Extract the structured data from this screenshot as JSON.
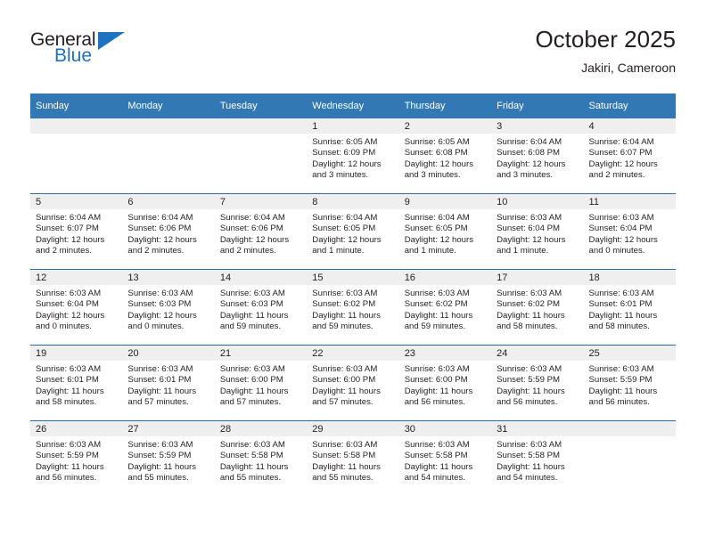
{
  "brand": {
    "name_top": "General",
    "name_bottom": "Blue",
    "accent_color": "#1f72bd"
  },
  "header": {
    "title": "October 2025",
    "location": "Jakiri, Cameroon"
  },
  "theme": {
    "header_bg": "#3178b4",
    "daynum_bg": "#efefef",
    "row_divider": "#2e6da4",
    "text": "#231f20"
  },
  "weekday_headers": [
    "Sunday",
    "Monday",
    "Tuesday",
    "Wednesday",
    "Thursday",
    "Friday",
    "Saturday"
  ],
  "weeks": [
    [
      {
        "day": "",
        "sunrise": "",
        "sunset": "",
        "daylight": "",
        "empty": true
      },
      {
        "day": "",
        "sunrise": "",
        "sunset": "",
        "daylight": "",
        "empty": true
      },
      {
        "day": "",
        "sunrise": "",
        "sunset": "",
        "daylight": "",
        "empty": true
      },
      {
        "day": "1",
        "sunrise": "Sunrise: 6:05 AM",
        "sunset": "Sunset: 6:09 PM",
        "daylight": "Daylight: 12 hours and 3 minutes."
      },
      {
        "day": "2",
        "sunrise": "Sunrise: 6:05 AM",
        "sunset": "Sunset: 6:08 PM",
        "daylight": "Daylight: 12 hours and 3 minutes."
      },
      {
        "day": "3",
        "sunrise": "Sunrise: 6:04 AM",
        "sunset": "Sunset: 6:08 PM",
        "daylight": "Daylight: 12 hours and 3 minutes."
      },
      {
        "day": "4",
        "sunrise": "Sunrise: 6:04 AM",
        "sunset": "Sunset: 6:07 PM",
        "daylight": "Daylight: 12 hours and 2 minutes."
      }
    ],
    [
      {
        "day": "5",
        "sunrise": "Sunrise: 6:04 AM",
        "sunset": "Sunset: 6:07 PM",
        "daylight": "Daylight: 12 hours and 2 minutes."
      },
      {
        "day": "6",
        "sunrise": "Sunrise: 6:04 AM",
        "sunset": "Sunset: 6:06 PM",
        "daylight": "Daylight: 12 hours and 2 minutes."
      },
      {
        "day": "7",
        "sunrise": "Sunrise: 6:04 AM",
        "sunset": "Sunset: 6:06 PM",
        "daylight": "Daylight: 12 hours and 2 minutes."
      },
      {
        "day": "8",
        "sunrise": "Sunrise: 6:04 AM",
        "sunset": "Sunset: 6:05 PM",
        "daylight": "Daylight: 12 hours and 1 minute."
      },
      {
        "day": "9",
        "sunrise": "Sunrise: 6:04 AM",
        "sunset": "Sunset: 6:05 PM",
        "daylight": "Daylight: 12 hours and 1 minute."
      },
      {
        "day": "10",
        "sunrise": "Sunrise: 6:03 AM",
        "sunset": "Sunset: 6:04 PM",
        "daylight": "Daylight: 12 hours and 1 minute."
      },
      {
        "day": "11",
        "sunrise": "Sunrise: 6:03 AM",
        "sunset": "Sunset: 6:04 PM",
        "daylight": "Daylight: 12 hours and 0 minutes."
      }
    ],
    [
      {
        "day": "12",
        "sunrise": "Sunrise: 6:03 AM",
        "sunset": "Sunset: 6:04 PM",
        "daylight": "Daylight: 12 hours and 0 minutes."
      },
      {
        "day": "13",
        "sunrise": "Sunrise: 6:03 AM",
        "sunset": "Sunset: 6:03 PM",
        "daylight": "Daylight: 12 hours and 0 minutes."
      },
      {
        "day": "14",
        "sunrise": "Sunrise: 6:03 AM",
        "sunset": "Sunset: 6:03 PM",
        "daylight": "Daylight: 11 hours and 59 minutes."
      },
      {
        "day": "15",
        "sunrise": "Sunrise: 6:03 AM",
        "sunset": "Sunset: 6:02 PM",
        "daylight": "Daylight: 11 hours and 59 minutes."
      },
      {
        "day": "16",
        "sunrise": "Sunrise: 6:03 AM",
        "sunset": "Sunset: 6:02 PM",
        "daylight": "Daylight: 11 hours and 59 minutes."
      },
      {
        "day": "17",
        "sunrise": "Sunrise: 6:03 AM",
        "sunset": "Sunset: 6:02 PM",
        "daylight": "Daylight: 11 hours and 58 minutes."
      },
      {
        "day": "18",
        "sunrise": "Sunrise: 6:03 AM",
        "sunset": "Sunset: 6:01 PM",
        "daylight": "Daylight: 11 hours and 58 minutes."
      }
    ],
    [
      {
        "day": "19",
        "sunrise": "Sunrise: 6:03 AM",
        "sunset": "Sunset: 6:01 PM",
        "daylight": "Daylight: 11 hours and 58 minutes."
      },
      {
        "day": "20",
        "sunrise": "Sunrise: 6:03 AM",
        "sunset": "Sunset: 6:01 PM",
        "daylight": "Daylight: 11 hours and 57 minutes."
      },
      {
        "day": "21",
        "sunrise": "Sunrise: 6:03 AM",
        "sunset": "Sunset: 6:00 PM",
        "daylight": "Daylight: 11 hours and 57 minutes."
      },
      {
        "day": "22",
        "sunrise": "Sunrise: 6:03 AM",
        "sunset": "Sunset: 6:00 PM",
        "daylight": "Daylight: 11 hours and 57 minutes."
      },
      {
        "day": "23",
        "sunrise": "Sunrise: 6:03 AM",
        "sunset": "Sunset: 6:00 PM",
        "daylight": "Daylight: 11 hours and 56 minutes."
      },
      {
        "day": "24",
        "sunrise": "Sunrise: 6:03 AM",
        "sunset": "Sunset: 5:59 PM",
        "daylight": "Daylight: 11 hours and 56 minutes."
      },
      {
        "day": "25",
        "sunrise": "Sunrise: 6:03 AM",
        "sunset": "Sunset: 5:59 PM",
        "daylight": "Daylight: 11 hours and 56 minutes."
      }
    ],
    [
      {
        "day": "26",
        "sunrise": "Sunrise: 6:03 AM",
        "sunset": "Sunset: 5:59 PM",
        "daylight": "Daylight: 11 hours and 56 minutes."
      },
      {
        "day": "27",
        "sunrise": "Sunrise: 6:03 AM",
        "sunset": "Sunset: 5:59 PM",
        "daylight": "Daylight: 11 hours and 55 minutes."
      },
      {
        "day": "28",
        "sunrise": "Sunrise: 6:03 AM",
        "sunset": "Sunset: 5:58 PM",
        "daylight": "Daylight: 11 hours and 55 minutes."
      },
      {
        "day": "29",
        "sunrise": "Sunrise: 6:03 AM",
        "sunset": "Sunset: 5:58 PM",
        "daylight": "Daylight: 11 hours and 55 minutes."
      },
      {
        "day": "30",
        "sunrise": "Sunrise: 6:03 AM",
        "sunset": "Sunset: 5:58 PM",
        "daylight": "Daylight: 11 hours and 54 minutes."
      },
      {
        "day": "31",
        "sunrise": "Sunrise: 6:03 AM",
        "sunset": "Sunset: 5:58 PM",
        "daylight": "Daylight: 11 hours and 54 minutes."
      },
      {
        "day": "",
        "sunrise": "",
        "sunset": "",
        "daylight": "",
        "empty": true
      }
    ]
  ]
}
